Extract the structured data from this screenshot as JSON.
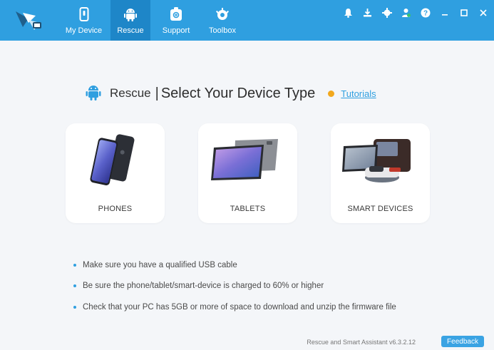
{
  "nav": {
    "tabs": [
      {
        "label": "My Device",
        "icon": "phone-icon"
      },
      {
        "label": "Rescue",
        "icon": "android-icon",
        "active": true
      },
      {
        "label": "Support",
        "icon": "support-icon"
      },
      {
        "label": "Toolbox",
        "icon": "toolbox-icon"
      }
    ]
  },
  "window_icons": [
    "bell-icon",
    "download-icon",
    "gear-icon",
    "user-icon",
    "help-icon",
    "minimize-icon",
    "maximize-icon",
    "close-icon"
  ],
  "header": {
    "prefix": "Rescue",
    "separator": "|",
    "title": "Select Your Device Type",
    "tutorials": "Tutorials"
  },
  "devices": [
    {
      "label": "PHONES"
    },
    {
      "label": "TABLETS"
    },
    {
      "label": "SMART DEVICES"
    }
  ],
  "tips": [
    "Make sure you have a qualified USB cable",
    "Be sure the phone/tablet/smart-device is charged to 60% or higher",
    "Check that your PC has 5GB or more of space to download and unzip the firmware file"
  ],
  "footer": {
    "version": "Rescue and Smart Assistant v6.3.2.12",
    "feedback": "Feedback"
  },
  "colors": {
    "accent": "#2f9fe0",
    "active_tab": "#1e86c8",
    "background": "#f4f6f9",
    "tutorial_dot": "#f2a81d"
  }
}
